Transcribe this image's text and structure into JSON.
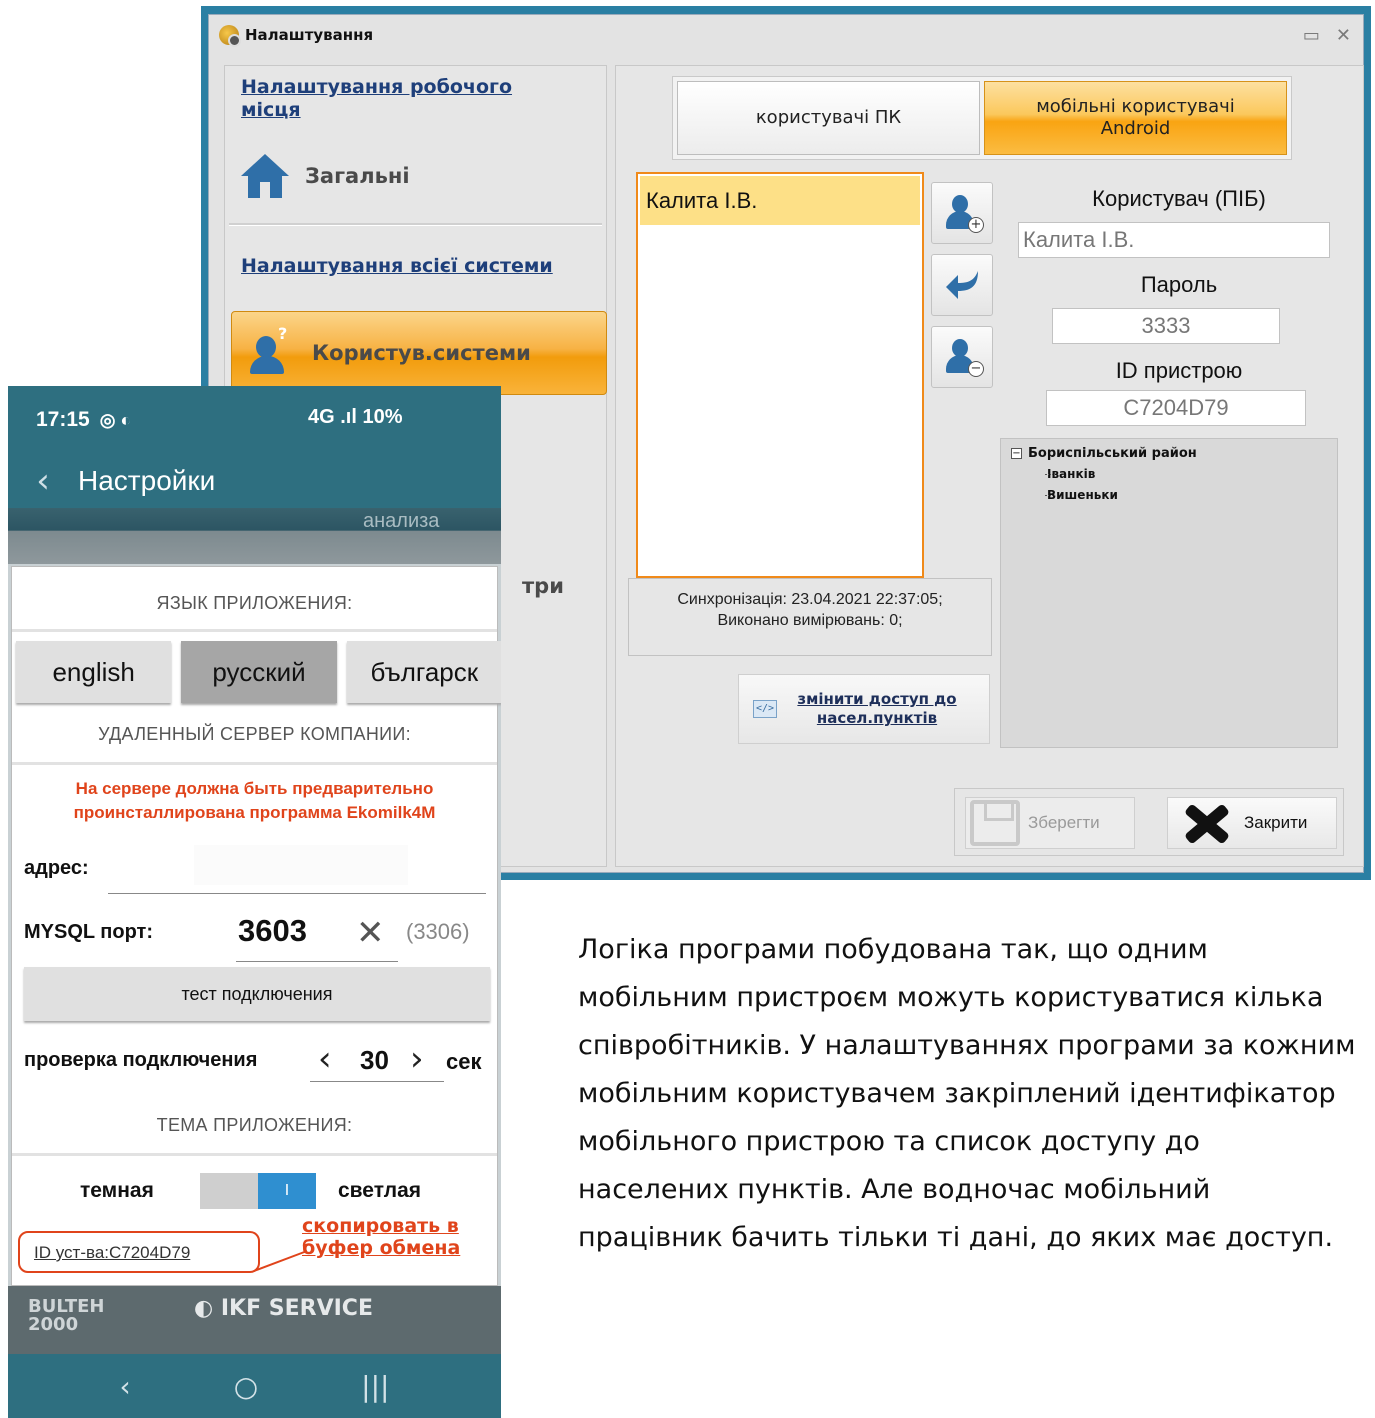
{
  "desktop": {
    "title": "Налаштування",
    "left_nav": {
      "workplace_section": "Налаштування робочого місця",
      "general": "Загальні",
      "system_section": "Налаштування всієї системи",
      "users": "Користув.системи",
      "more_partial": "три"
    },
    "tabs": [
      {
        "label": "користувачі ПК",
        "active": false
      },
      {
        "label": "мобільні користувачі\nAndroid",
        "active": true
      }
    ],
    "users_list": [
      "Калита І.В."
    ],
    "sync_info": "Синхронізація: 23.04.2021 22:37:05;\nВиконано вимірювань: 0;",
    "access_button": "змінити доступ до насел.пунктів",
    "user_label": "Користувач (ПІБ)",
    "user_value": "Калита І.В.",
    "password_label": "Пароль",
    "password_value": "3333",
    "device_id_label": "ID пристрою",
    "device_id_value": "C7204D79",
    "tree": {
      "root": "Бориспільський район",
      "children": [
        "Іванків",
        "Вишеньки"
      ]
    },
    "save_label": "Зберегти",
    "close_label": "Закрити",
    "icons": {
      "app": "settings-gear-icon",
      "general": "home-icon",
      "users": "user-question-icon",
      "add": "user-add-icon",
      "back": "return-arrow-icon",
      "remove": "user-remove-icon",
      "save": "floppy-icon",
      "close": "close-x-icon"
    },
    "accent_orange": "#f9a412",
    "accent_blue": "#2f6fa8"
  },
  "phone": {
    "status_time": "17:15",
    "status_right": "4G .ıl 10%",
    "header_title": "Настройки",
    "banner_text": "анализа",
    "lang_section": "ЯЗЫК ПРИЛОЖЕНИЯ:",
    "languages": [
      {
        "label": "english",
        "selected": false
      },
      {
        "label": "русский",
        "selected": true
      },
      {
        "label": "българск",
        "selected": false
      }
    ],
    "server_section": "УДАЛЕННЫЙ СЕРВЕР КОМПАНИИ:",
    "server_warning": "На сервере должна быть предварительно проинсталлирована программа Ekomilk4M",
    "address_label": "адрес:",
    "address_value": "",
    "mysql_label": "MYSQL порт:",
    "mysql_value": "3603",
    "mysql_default": "(3306)",
    "test_button": "тест подключения",
    "check_label": "проверка подключения",
    "check_value": "30",
    "check_unit": "сек",
    "theme_section": "ТЕМА ПРИЛОЖЕНИЯ:",
    "theme_dark": "темная",
    "theme_light": "светлая",
    "toggle_mark": "I",
    "device_id": "ID уст-ва:C7204D79",
    "copy_note": "скопировать в буфер обмена",
    "logo1": "BULTEH 2000",
    "logo2": "IKF SERVICE",
    "accent_red": "#e0441b",
    "accent_teal": "#2e6f80"
  },
  "description": "Логіка програми побудована так, що одним мобільним пристроєм можуть користуватися кілька співробітників. У налаштуваннях програми за кожним мобільним користувачем закріплений ідентифікатор мобільного пристрою та список доступу до населених пунктів. Але водночас мобільний працівник бачить тільки ті дані, до яких має доступ."
}
